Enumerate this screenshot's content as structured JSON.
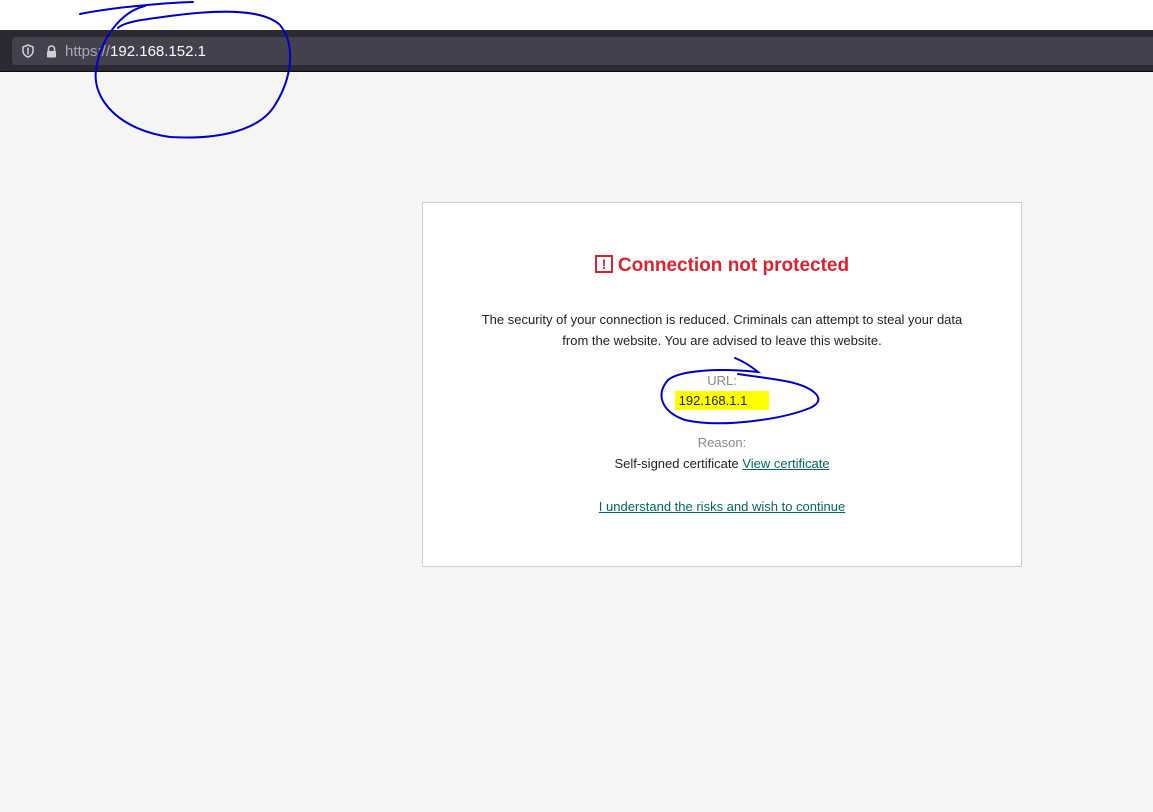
{
  "browser": {
    "url_scheme": "https://",
    "url_host": "192.168.152.1",
    "shield_icon": "shield-icon",
    "lock_icon": "lock-icon"
  },
  "warning": {
    "icon": "!",
    "title": "Connection not protected",
    "description": "The security of your connection is reduced. Criminals can attempt to steal your data from the website. You are advised to leave this website.",
    "url_label": "URL:",
    "url_value": "192.168.1.1",
    "reason_label": "Reason:",
    "reason_value": "Self-signed certificate",
    "view_certificate": "View certificate",
    "continue_link": "I understand the risks and wish to continue"
  },
  "colors": {
    "title": "#e0202e",
    "link": "#00695c",
    "highlight": "#ffff00",
    "annotation": "#0000cc"
  }
}
